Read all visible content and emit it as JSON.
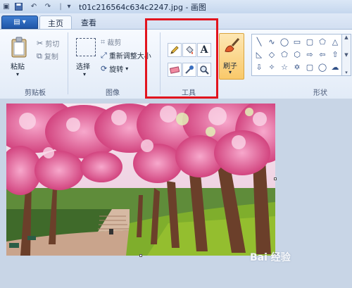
{
  "window": {
    "title": "t01c216564c634c2247.jpg - 画图"
  },
  "tabs": {
    "home": "主页",
    "view": "查看"
  },
  "clipboard": {
    "paste": "粘贴",
    "cut": "剪切",
    "copy": "复制",
    "group": "剪贴板"
  },
  "image": {
    "select": "选择",
    "crop": "裁剪",
    "resize": "重新调整大小",
    "rotate": "旋转",
    "group": "图像"
  },
  "tools": {
    "group": "工具",
    "text_glyph": "A"
  },
  "brushes": {
    "label": "刷子"
  },
  "shapes": {
    "group": "形状"
  },
  "watermark": {
    "text": "Bai 经验"
  },
  "colors": {
    "highlight": "#e2141e",
    "file_button": "#2a63b8",
    "canvas_bg": "#c8d5e6"
  },
  "icons": [
    "save-icon",
    "undo-icon",
    "redo-icon",
    "paste-icon",
    "cut-icon",
    "copy-icon",
    "select-icon",
    "crop-icon",
    "resize-icon",
    "rotate-icon",
    "pencil-icon",
    "fill-icon",
    "text-icon",
    "eraser-icon",
    "color-picker-icon",
    "magnifier-icon",
    "brush-icon"
  ]
}
